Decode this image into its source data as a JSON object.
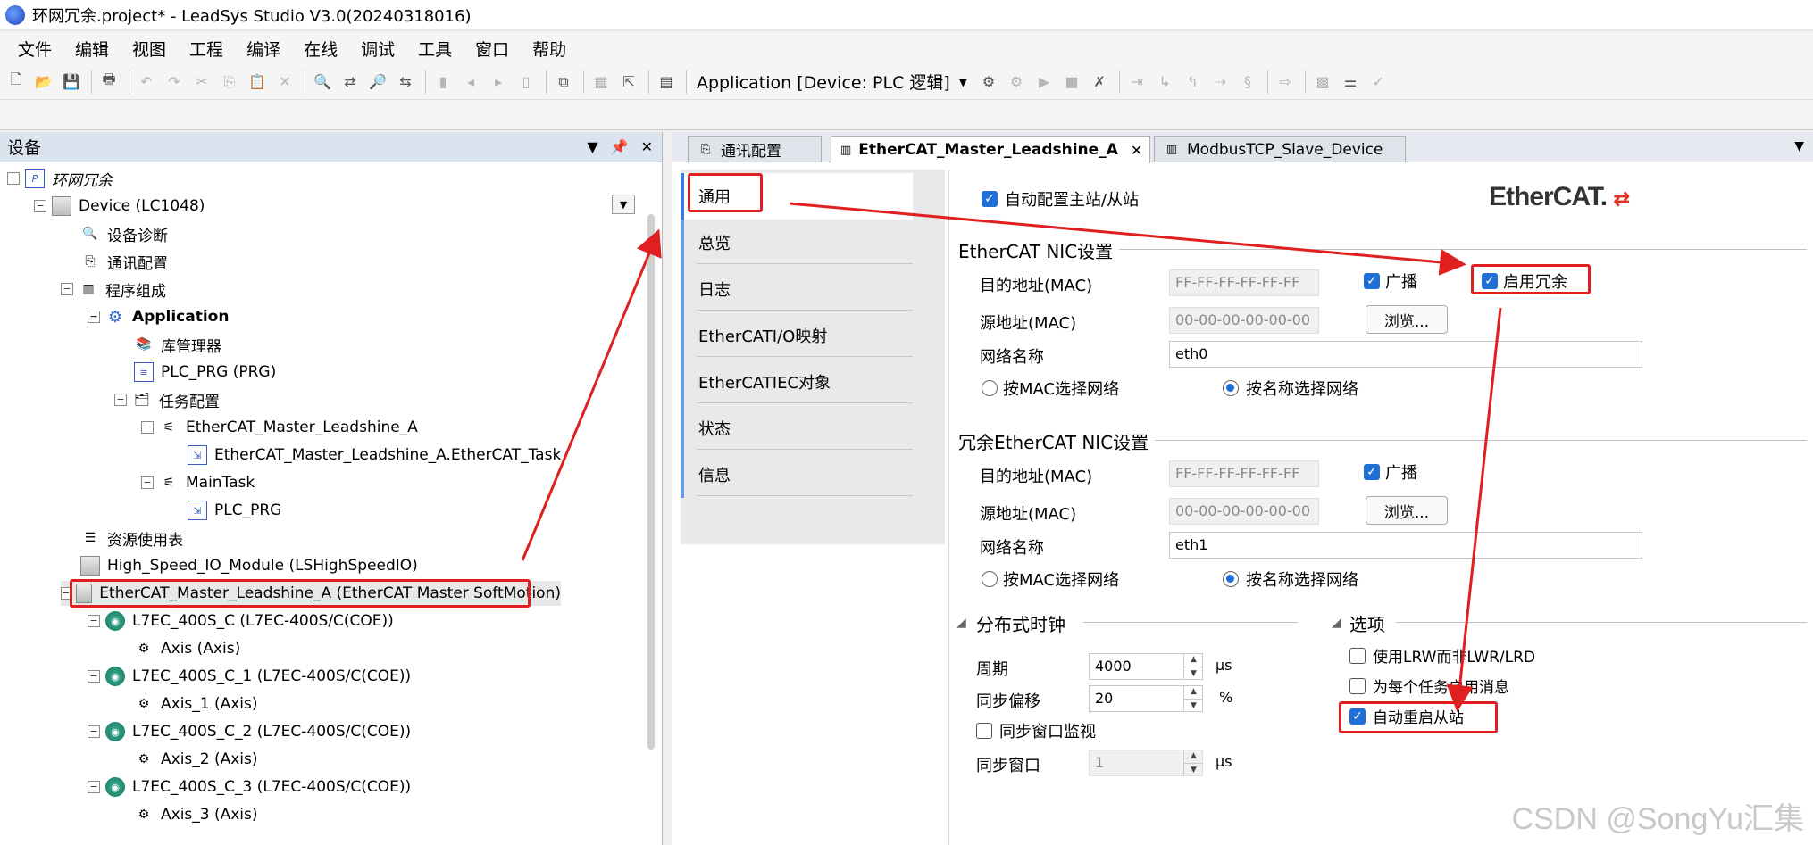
{
  "window": {
    "title": "环网冗余.project* - LeadSys Studio V3.0(20240318016)"
  },
  "menu": [
    "文件",
    "编辑",
    "视图",
    "工程",
    "编译",
    "在线",
    "调试",
    "工具",
    "窗口",
    "帮助"
  ],
  "toolbar": {
    "app_selector": "Application [Device: PLC 逻辑]"
  },
  "device_panel": {
    "title": "设备",
    "tree": [
      {
        "label": "环网冗余"
      },
      {
        "label": "Device (LC1048)"
      },
      {
        "label": "设备诊断"
      },
      {
        "label": "通讯配置"
      },
      {
        "label": "程序组成"
      },
      {
        "label": "Application"
      },
      {
        "label": "库管理器"
      },
      {
        "label": "PLC_PRG (PRG)"
      },
      {
        "label": "任务配置"
      },
      {
        "label": "EtherCAT_Master_Leadshine_A"
      },
      {
        "label": "EtherCAT_Master_Leadshine_A.EtherCAT_Task"
      },
      {
        "label": "MainTask"
      },
      {
        "label": "PLC_PRG"
      },
      {
        "label": "资源使用表"
      },
      {
        "label": "High_Speed_IO_Module (LSHighSpeedIO)"
      },
      {
        "label": "EtherCAT_Master_Leadshine_A (EtherCAT Master SoftMotion)"
      },
      {
        "label": "L7EC_400S_C (L7EC-400S/C(COE))"
      },
      {
        "label": "Axis (Axis)"
      },
      {
        "label": "L7EC_400S_C_1 (L7EC-400S/C(COE))"
      },
      {
        "label": "Axis_1 (Axis)"
      },
      {
        "label": "L7EC_400S_C_2 (L7EC-400S/C(COE))"
      },
      {
        "label": "Axis_2 (Axis)"
      },
      {
        "label": "L7EC_400S_C_3 (L7EC-400S/C(COE))"
      },
      {
        "label": "Axis_3 (Axis)"
      }
    ]
  },
  "tabs": [
    {
      "label": "通讯配置"
    },
    {
      "label": "EtherCAT_Master_Leadshine_A"
    },
    {
      "label": "ModbusTCP_Slave_Device"
    }
  ],
  "sidenav": [
    "通用",
    "总览",
    "日志",
    "EtherCATI/O映射",
    "EtherCATIEC对象",
    "状态",
    "信息"
  ],
  "general": {
    "auto_config": {
      "label": "自动配置主站/从站",
      "checked": true
    },
    "logo": {
      "prefix": "Ether",
      "suffix": "CAT."
    },
    "nic": {
      "title": "EtherCAT NIC设置",
      "dest_label": "目的地址(MAC)",
      "dest_value": "FF-FF-FF-FF-FF-FF",
      "broadcast_label": "广播",
      "redundancy_label": "启用冗余",
      "src_label": "源地址(MAC)",
      "src_value": "00-00-00-00-00-00",
      "browse": "浏览...",
      "net_label": "网络名称",
      "net_value": "eth0",
      "radio_mac": "按MAC选择网络",
      "radio_name": "按名称选择网络"
    },
    "redundant_nic": {
      "title": "冗余EtherCAT NIC设置",
      "dest_label": "目的地址(MAC)",
      "dest_value": "FF-FF-FF-FF-FF-FF",
      "broadcast_label": "广播",
      "src_label": "源地址(MAC)",
      "src_value": "00-00-00-00-00-00",
      "browse": "浏览...",
      "net_label": "网络名称",
      "net_value": "eth1",
      "radio_mac": "按MAC选择网络",
      "radio_name": "按名称选择网络"
    },
    "dc": {
      "title": "分布式时钟",
      "period_label": "周期",
      "period_value": "4000",
      "period_unit": "µs",
      "offset_label": "同步偏移",
      "offset_value": "20",
      "offset_unit": "%",
      "sync_window_monitor": "同步窗口监视",
      "sync_window_label": "同步窗口",
      "sync_window_value": "1",
      "sync_window_unit": "µs"
    },
    "options": {
      "title": "选项",
      "lrw": "使用LRW而非LWR/LRD",
      "per_task_msg": "为每个任务启用消息",
      "auto_restart": "自动重启从站"
    }
  },
  "watermark": "CSDN @SongYu汇集",
  "colors": {
    "annotation": "#e02020",
    "checkbox": "#1f6fd6"
  }
}
